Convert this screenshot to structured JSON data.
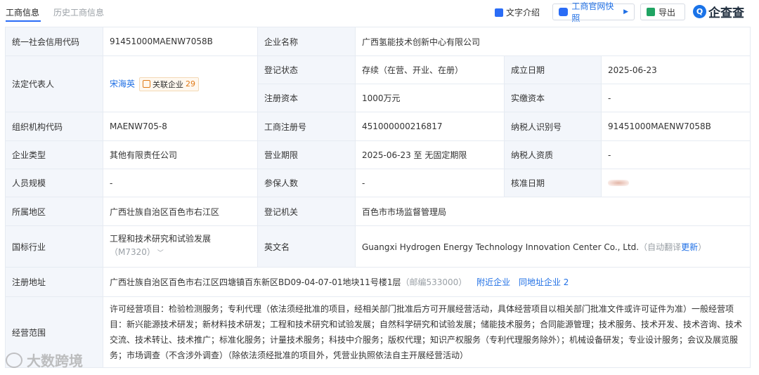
{
  "tabs": {
    "active": "工商信息",
    "inactive": "历史工商信息"
  },
  "toolbar": {
    "intro": "文字介绍",
    "snapshot": "工商官网快照",
    "export": "导出",
    "brand": "企查查",
    "brand_letter": "Q"
  },
  "colors": {
    "accent": "#1f6fe5",
    "label_bg": "#f3f6fb",
    "border": "#e6ebf2"
  },
  "info": {
    "credit_code_label": "统一社会信用代码",
    "credit_code": "91451000MAENW7058B",
    "company_name_label": "企业名称",
    "company_name": "广西氢能技术创新中心有限公司",
    "legal_rep_label": "法定代表人",
    "legal_rep": "宋海英",
    "related_label": "关联企业",
    "related_count": "29",
    "status_label": "登记状态",
    "status": "存续（在营、开业、在册）",
    "founded_label": "成立日期",
    "founded": "2025-06-23",
    "reg_capital_label": "注册资本",
    "reg_capital": "1000万元",
    "paid_capital_label": "实缴资本",
    "paid_capital": "-",
    "org_code_label": "组织机构代码",
    "org_code": "MAENW705-8",
    "reg_no_label": "工商注册号",
    "reg_no": "451000000216817",
    "taxpayer_id_label": "纳税人识别号",
    "taxpayer_id": "91451000MAENW7058B",
    "type_label": "企业类型",
    "type": "其他有限责任公司",
    "term_label": "营业期限",
    "term": "2025-06-23 至 无固定期限",
    "taxpayer_qual_label": "纳税人资质",
    "taxpayer_qual": "-",
    "staff_label": "人员规模",
    "staff": "-",
    "insured_label": "参保人数",
    "insured": "-",
    "approval_label": "核准日期",
    "region_label": "所属地区",
    "region": "广西壮族自治区百色市右江区",
    "authority_label": "登记机关",
    "authority": "百色市市场监督管理局",
    "industry_label": "国标行业",
    "industry": "工程和技术研究和试验发展",
    "industry_code": "（M7320）",
    "english_label": "英文名",
    "english": "Guangxi Hydrogen Energy Technology Innovation Center Co., Ltd.",
    "auto_translate": "（自动翻译",
    "update": "更新",
    "paren_close": "）",
    "address_label": "注册地址",
    "address": "广西壮族自治区百色市右江区四塘镇百东新区BD09-04-07-01地块11号楼1层",
    "postcode": "（邮编533000）",
    "nearby": "附近企业",
    "same_address": "同地址企业",
    "same_address_count": "2",
    "scope_label": "经营范围",
    "scope": "许可经营项目：检验检测服务；专利代理（依法须经批准的项目，经相关部门批准后方可开展经营活动，具体经营项目以相关部门批准文件或许可证件为准）一般经营项目：新兴能源技术研发；新材料技术研发；工程和技术研究和试验发展；自然科学研究和试验发展；储能技术服务；合同能源管理；技术服务、技术开发、技术咨询、技术交流、技术转让、技术推广；标准化服务；计量技术服务；科技中介服务；版权代理；知识产权服务（专利代理服务除外）；机械设备研发；专业设计服务；会议及展览服务；市场调查（不含涉外调查）（除依法须经批准的项目外，凭营业执照依法自主开展经营活动）"
  },
  "watermark": "大数跨境"
}
